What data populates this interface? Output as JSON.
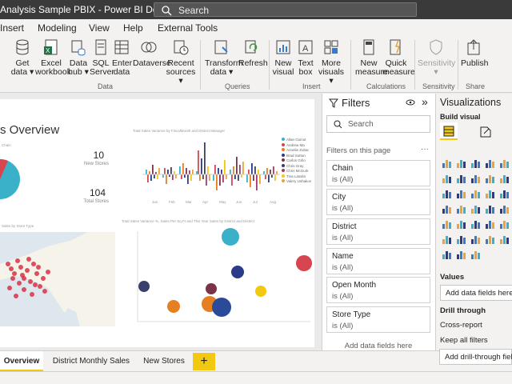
{
  "titlebar": {
    "title": "Analysis Sample PBIX - Power BI Des...",
    "search_placeholder": "Search"
  },
  "menu": [
    "Insert",
    "Modeling",
    "View",
    "Help",
    "External Tools"
  ],
  "ribbon": {
    "buttons": [
      {
        "l1": "Get",
        "l2": "data ▾"
      },
      {
        "l1": "Excel",
        "l2": "workbook"
      },
      {
        "l1": "Data",
        "l2": "hub ▾"
      },
      {
        "l1": "SQL",
        "l2": "Server"
      },
      {
        "l1": "Enter",
        "l2": "data"
      },
      {
        "l1": "Dataverse",
        "l2": ""
      },
      {
        "l1": "Recent",
        "l2": "sources ▾"
      },
      {
        "l1": "Transform",
        "l2": "data ▾"
      },
      {
        "l1": "Refresh",
        "l2": ""
      },
      {
        "l1": "New",
        "l2": "visual"
      },
      {
        "l1": "Text",
        "l2": "box"
      },
      {
        "l1": "More",
        "l2": "visuals ▾"
      },
      {
        "l1": "New",
        "l2": "measure"
      },
      {
        "l1": "Quick",
        "l2": "measure"
      },
      {
        "l1": "Sensitivity",
        "l2": "▾"
      },
      {
        "l1": "Publish",
        "l2": ""
      }
    ],
    "groups": [
      "Data",
      "Queries",
      "Insert",
      "Calculations",
      "Sensitivity",
      "Share"
    ]
  },
  "report": {
    "title": "s Overview",
    "kpis": [
      {
        "value": "10",
        "label": "New Stores"
      },
      {
        "value": "104",
        "label": "Total Stores"
      }
    ],
    "chart1_title": "Total Sales Variance by FiscalMonth and District Manager",
    "chart2_title": "Total Sales Variance %, Sales Per Sq Ft and This Year Sales by District and District",
    "map_title": "Sales by Store Type",
    "pie_label": "Chain",
    "chart1_legend": [
      "Allan Guinot",
      "Andrew Ma",
      "Annelie Zubar",
      "Brad Sutton",
      "Carlos Grilo",
      "Chris Gray",
      "Chris McGurk",
      "Tina Lassila",
      "Valery Ushakov"
    ],
    "chart1_months": [
      "Jan",
      "Feb",
      "Mar",
      "Apr",
      "May",
      "Jun",
      "Jul",
      "Aug"
    ]
  },
  "chart_data": {
    "type": "bar",
    "title": "Total Sales Variance by FiscalMonth and District Manager",
    "categories": [
      "Jan",
      "Feb",
      "Mar",
      "Apr",
      "May",
      "Jun",
      "Jul",
      "Aug"
    ],
    "ylim": [
      -100,
      150
    ]
  },
  "filters": {
    "title": "Filters",
    "search_placeholder": "Search",
    "on_page_label": "Filters on this page",
    "cards": [
      {
        "name": "Chain",
        "value": "is (All)"
      },
      {
        "name": "City",
        "value": "is (All)"
      },
      {
        "name": "District",
        "value": "is (All)"
      },
      {
        "name": "Name",
        "value": "is (All)"
      },
      {
        "name": "Open Month",
        "value": "is (All)"
      },
      {
        "name": "Store Type",
        "value": "is (All)"
      }
    ],
    "add_label": "Add data fields here"
  },
  "visualizations": {
    "title": "Visualizations",
    "build_label": "Build visual",
    "values_label": "Values",
    "values_placeholder": "Add data fields here",
    "drill_label": "Drill through",
    "cross_report": "Cross-report",
    "keep_filters": "Keep all filters",
    "drill_placeholder": "Add drill-through fields"
  },
  "tabs": [
    "Overview",
    "District Monthly Sales",
    "New Stores"
  ],
  "add_tab": "+",
  "colors": {
    "accent": "#f2c811",
    "teal": "#3bb0c9",
    "red": "#d64550",
    "navy": "#2b3a8a",
    "orange": "#e67e22"
  }
}
